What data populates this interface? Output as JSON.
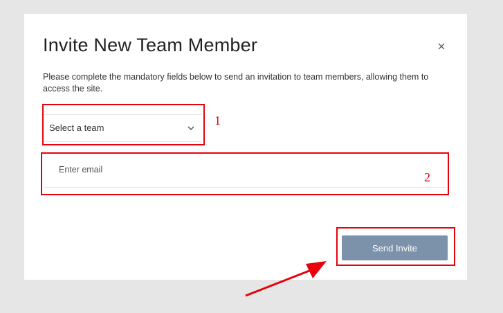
{
  "dialog": {
    "title": "Invite New Team Member",
    "close_icon": "close-icon",
    "description": "Please complete the mandatory fields below to send an invitation to team members, allowing them to access the site.",
    "team_select": {
      "value": "Select a team",
      "icon": "chevron-down-icon"
    },
    "email_input": {
      "placeholder": "Enter email",
      "value": ""
    },
    "send_button_label": "Send Invite"
  },
  "annotations": {
    "labels": [
      "1",
      "2"
    ],
    "color": "#e8000b"
  },
  "colors": {
    "button": "#7c91aa",
    "backdrop": "#e6e6e6",
    "dialog": "#ffffff"
  }
}
